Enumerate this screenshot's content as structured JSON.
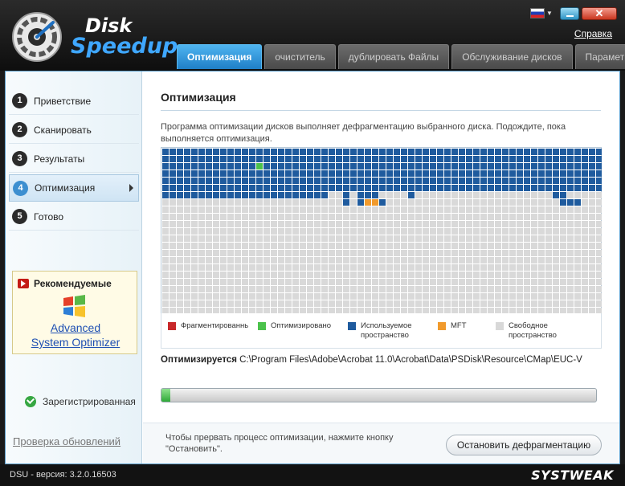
{
  "app": {
    "logo_line1": "Disk",
    "logo_line2": "Speedup",
    "help_link": "Справка",
    "close_glyph": "✕"
  },
  "tabs": [
    {
      "label": "Оптимизация",
      "active": true
    },
    {
      "label": "очиститель",
      "active": false
    },
    {
      "label": "дублировать Файлы",
      "active": false
    },
    {
      "label": "Обслуживание дисков",
      "active": false
    },
    {
      "label": "Параметры",
      "active": false
    }
  ],
  "sidebar": {
    "steps": [
      {
        "num": "1",
        "label": "Приветствие"
      },
      {
        "num": "2",
        "label": "Сканировать"
      },
      {
        "num": "3",
        "label": "Результаты"
      },
      {
        "num": "4",
        "label": "Оптимизация",
        "active": true
      },
      {
        "num": "5",
        "label": "Готово"
      }
    ],
    "promo": {
      "title": "Рекомендуемые",
      "link_line1": "Advanced",
      "link_line2": "System Optimizer"
    },
    "registered": "Зарегистрированная",
    "update_link": "Проверка обновлений"
  },
  "content": {
    "title": "Оптимизация",
    "description": "Программа оптимизации дисков выполняет дефрагментацию выбранного диска. Подождите, пока выполняется оптимизация.",
    "legend": [
      {
        "label": "Фрагментированные",
        "color": "#c8282a"
      },
      {
        "label": "Оптимизировано",
        "color": "#4bc24b"
      },
      {
        "label": "Используемое пространство",
        "color": "#1f5b9e"
      },
      {
        "label": "MFT",
        "color": "#f19a2c"
      },
      {
        "label": "Свободное пространство",
        "color": "#d8d8d8"
      }
    ],
    "current_label": "Оптимизируется",
    "current_path": "C:\\Program Files\\Adobe\\Acrobat 11.0\\Acrobat\\Data\\PSDisk\\Resource\\CMap\\EUC-V",
    "progress_percent": 2,
    "hint": "Чтобы прервать процесс оптимизации, нажмите кнопку \"Остановить\".",
    "stop_button": "Остановить дефрагментацию"
  },
  "statusbar": {
    "version": "DSU - версия: 3.2.0.16503",
    "brand": "SYSTWEAK"
  },
  "colors": {
    "used": "#1f5b9e",
    "free": "#d9d9d9",
    "optimized": "#4bc24b",
    "mft": "#f19a2c",
    "accent": "#2a8ad4"
  }
}
